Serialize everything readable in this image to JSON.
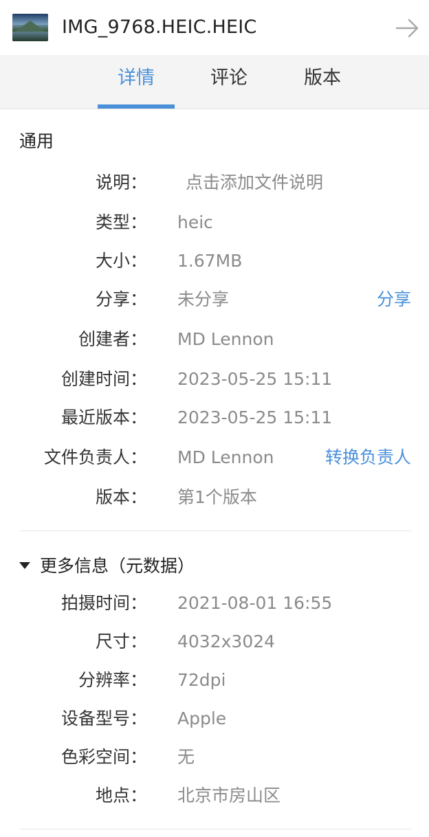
{
  "header": {
    "file_name": "IMG_9768.HEIC.HEIC"
  },
  "tabs": [
    {
      "label": "详情",
      "active": true
    },
    {
      "label": "评论",
      "active": false
    },
    {
      "label": "版本",
      "active": false
    }
  ],
  "general": {
    "title": "通用",
    "rows": [
      {
        "label": "说明：",
        "value": "点击添加文件说明"
      },
      {
        "label": "类型：",
        "value": "heic"
      },
      {
        "label": "大小：",
        "value": "1.67MB"
      },
      {
        "label": "分享：",
        "value": "未分享",
        "action": "分享"
      },
      {
        "label": "创建者：",
        "value": "MD Lennon"
      },
      {
        "label": "创建时间：",
        "value": "2023-05-25 15:11"
      },
      {
        "label": "最近版本：",
        "value": "2023-05-25 15:11"
      },
      {
        "label": "文件负责人：",
        "value": "MD Lennon",
        "action": "转换负责人"
      },
      {
        "label": "版本：",
        "value": "第1个版本"
      }
    ]
  },
  "metadata": {
    "title": "更多信息（元数据）",
    "expanded": true,
    "rows": [
      {
        "label": "拍摄时间：",
        "value": "2021-08-01 16:55"
      },
      {
        "label": "尺寸：",
        "value": "4032x3024"
      },
      {
        "label": "分辨率：",
        "value": "72dpi"
      },
      {
        "label": "设备型号：",
        "value": "Apple"
      },
      {
        "label": "色彩空间：",
        "value": "无"
      },
      {
        "label": "地点：",
        "value": "北京市房山区"
      }
    ]
  },
  "colors": {
    "accent": "#4a90d9",
    "label_text": "#333333",
    "value_text": "#8a8a8a",
    "tab_bar_bg": "#f4f4f4"
  }
}
